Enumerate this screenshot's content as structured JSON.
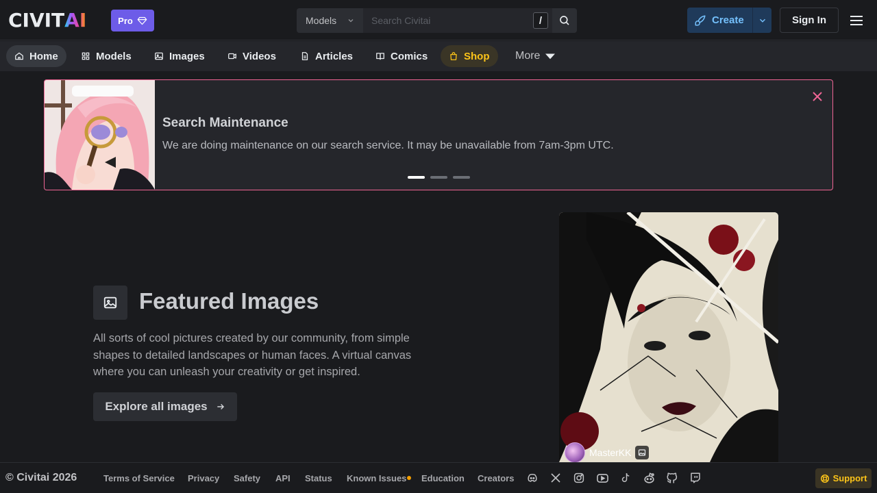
{
  "brand": {
    "logo_main": "CIVIT",
    "logo_accent": "AI",
    "pro_label": "Pro"
  },
  "search": {
    "scope": "Models",
    "placeholder": "Search Civitai",
    "shortcut": "/"
  },
  "header": {
    "create_label": "Create",
    "signin_label": "Sign In"
  },
  "nav": {
    "tabs": [
      {
        "label": "Home",
        "icon": "home-icon",
        "active": true
      },
      {
        "label": "Models",
        "icon": "grid-icon"
      },
      {
        "label": "Images",
        "icon": "photo-icon"
      },
      {
        "label": "Videos",
        "icon": "video-icon"
      },
      {
        "label": "Articles",
        "icon": "file-text-icon"
      },
      {
        "label": "Comics",
        "icon": "book-icon"
      },
      {
        "label": "Shop",
        "icon": "shopping-bag-icon"
      },
      {
        "label": "More",
        "icon": "caret-down-icon"
      }
    ]
  },
  "banner": {
    "title": "Search Maintenance",
    "message": "We are doing maintenance on our search service. It may be unavailable from 7am-3pm UTC.",
    "slides": 3,
    "active_slide": 1
  },
  "featured": {
    "title": "Featured Images",
    "description": "All sorts of cool pictures created by our community, from simple shapes to detailed landscapes or human faces. A virtual canvas where you can unleash your creativity or get inspired.",
    "cta": "Explore all images",
    "creator": "MasterKK"
  },
  "footer": {
    "copyright": "© Civitai 2026",
    "links": [
      "Terms of Service",
      "Privacy",
      "Safety",
      "API",
      "Status",
      "Known Issues",
      "Education",
      "Creators"
    ],
    "social": [
      "discord-icon",
      "x-icon",
      "instagram-icon",
      "youtube-icon",
      "tiktok-icon",
      "reddit-icon",
      "github-icon",
      "twitch-icon"
    ],
    "support_label": "Support"
  },
  "colors": {
    "background": "#1a1b1e",
    "accent_blue": "#74c0fc",
    "pro_purple": "#6d5ce8",
    "shop_yellow": "#fcc419",
    "banner_border": "#f06595",
    "status_orange": "#f59f00"
  }
}
